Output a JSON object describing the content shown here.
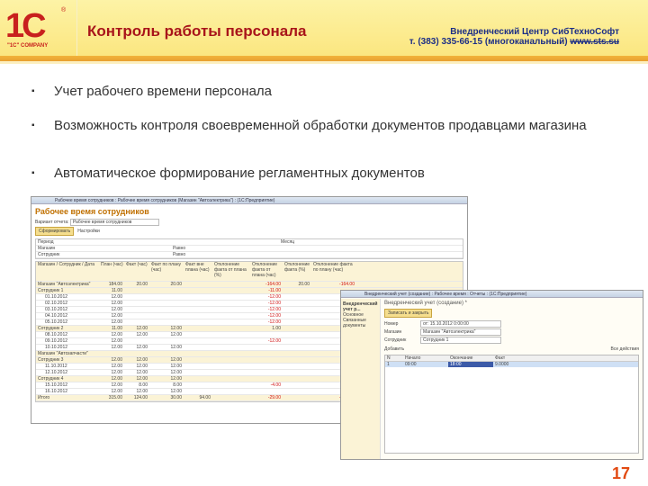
{
  "header": {
    "logo_text": "1С",
    "logo_caption": "\"1C\" COMPANY",
    "title": "Контроль работы персонала",
    "company": "Внедренческий Центр СибТехноСофт",
    "phone": "т. (383) 335-66-15 (многоканальный)",
    "site": "www.sts.su"
  },
  "bullets": [
    "Учет рабочего времени персонала",
    "Возможность контроля своевременной обработки документов продавцами магазина",
    "Автоматическое формирование регламентных документов"
  ],
  "report": {
    "window_title": "Рабочее время сотрудников : Рабочее время сотрудников (Магазин \"Автоэлектрика\") : (1С:Предприятие)",
    "title": "Рабочее время сотрудников",
    "variant_label": "Вариант отчета:",
    "variant_value": "Рабочее время сотрудников",
    "generate": "Сформировать",
    "settings": "Настройки",
    "filters": [
      {
        "name": "Период",
        "value": "",
        "extra": "Месяц"
      },
      {
        "name": "Магазин",
        "value": "Равно",
        "extra": ""
      },
      {
        "name": "Сотрудник",
        "value": "Равно",
        "extra": ""
      }
    ],
    "columns": [
      "Магазин / Сотрудник / Дата",
      "План (час)",
      "Факт (час)",
      "Факт по плану (час)",
      "Факт вне плана (час)",
      "Отклонение факта от плана (%)",
      "Отклонение факта от плана (час)",
      "Отклонение факта (%)",
      "Отклонение факта по плану (час)"
    ],
    "rows": [
      [
        "Магазин \"Автоэлектрика\"",
        "184.00",
        "20.00",
        "20.00",
        "",
        "",
        "-164.00",
        "20.00",
        "-164.00"
      ],
      [
        "Сотрудник 1",
        "11.00",
        "",
        "",
        "",
        "",
        "-11.00",
        "",
        ""
      ],
      [
        "01.10.2012",
        "12.00",
        "",
        "",
        "",
        "",
        "-12.00",
        "",
        ""
      ],
      [
        "02.10.2012",
        "12.00",
        "",
        "",
        "",
        "",
        "-12.00",
        "",
        ""
      ],
      [
        "03.10.2012",
        "12.00",
        "",
        "",
        "",
        "",
        "-12.00",
        "",
        ""
      ],
      [
        "04.10.2012",
        "12.00",
        "",
        "",
        "",
        "",
        "-12.00",
        "",
        ""
      ],
      [
        "05.10.2012",
        "12.00",
        "",
        "",
        "",
        "",
        "-12.00",
        "",
        ""
      ],
      [
        "Сотрудник 2",
        "11.00",
        "12.00",
        "12.00",
        "",
        "",
        "1.00",
        "",
        ""
      ],
      [
        "08.10.2012",
        "12.00",
        "12.00",
        "12.00",
        "",
        "",
        "",
        "",
        ""
      ],
      [
        "09.10.2012",
        "12.00",
        "",
        "",
        "",
        "",
        "-12.00",
        "",
        ""
      ],
      [
        "10.10.2012",
        "12.00",
        "12.00",
        "12.00",
        "",
        "",
        "",
        "",
        ""
      ],
      [
        "Магазин \"Автозапчасти\"",
        "",
        "",
        "",
        "",
        "",
        "",
        "",
        ""
      ],
      [
        "Сотрудник 3",
        "12.00",
        "12.00",
        "12.00",
        "",
        "",
        "",
        "",
        ""
      ],
      [
        "11.10.2012",
        "12.00",
        "12.00",
        "12.00",
        "",
        "",
        "",
        "",
        ""
      ],
      [
        "12.10.2012",
        "12.00",
        "12.00",
        "12.00",
        "",
        "",
        "",
        "",
        ""
      ],
      [
        "Сотрудник 4",
        "12.00",
        "12.00",
        "12.00",
        "",
        "",
        "",
        "",
        ""
      ],
      [
        "15.10.2012",
        "12.00",
        "8.00",
        "8.00",
        "",
        "",
        "-4.00",
        "",
        ""
      ],
      [
        "16.10.2012",
        "12.00",
        "12.00",
        "12.00",
        "",
        "",
        "",
        "",
        ""
      ],
      [
        "Итого",
        "315.00",
        "124.00",
        "30.00",
        "94.00",
        "",
        "-29.00",
        "",
        "-134.00"
      ]
    ]
  },
  "doc": {
    "window_title": "Внедренческий учет (создание) : Рабочее время : Отчеты : (1С:Предприятие)",
    "side_title": "Внедренческий учет р...",
    "side_items": [
      "Основное",
      "Связанные документы"
    ],
    "title": "Внедренческий учет (создание) *",
    "save_close": "Записать и закрыть",
    "fields": [
      {
        "label": "Номер",
        "value": "от: 15.10.2012 0:00:00"
      },
      {
        "label": "Магазин",
        "value": "Магазин \"Автоэлектрика\""
      },
      {
        "label": "Сотрудник",
        "value": "Сотрудник 1"
      }
    ],
    "table_cols": [
      "N",
      "Начало",
      "Окончание",
      "Факт"
    ],
    "table_rows": [
      [
        "1",
        "09:00",
        "18:00",
        "9.0000"
      ]
    ],
    "add": "Добавить",
    "more": "Все действия"
  },
  "page_number": "17",
  "colors": {
    "title": "#a8141a",
    "company": "#1c2e86",
    "page_number": "#e24a12"
  }
}
